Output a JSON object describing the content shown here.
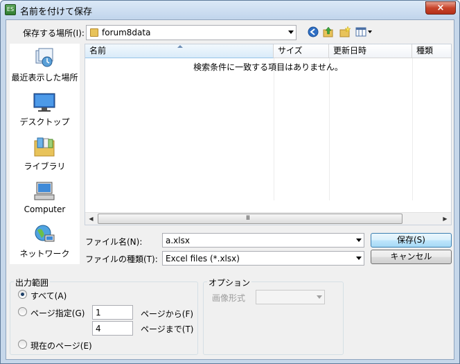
{
  "window": {
    "title": "名前を付けて保存",
    "app_icon_text": "ES",
    "close_label": "×"
  },
  "toolbar": {
    "save_in_label": "保存する場所(I):",
    "location": "forum8data",
    "icons": [
      "back-icon",
      "up-folder-icon",
      "new-folder-icon",
      "view-menu-icon"
    ]
  },
  "places": [
    {
      "label": "最近表示した場所",
      "icon": "recent-places-icon"
    },
    {
      "label": "デスクトップ",
      "icon": "desktop-icon"
    },
    {
      "label": "ライブラリ",
      "icon": "libraries-icon"
    },
    {
      "label": "Computer",
      "icon": "computer-icon"
    },
    {
      "label": "ネットワーク",
      "icon": "network-icon"
    }
  ],
  "filelist": {
    "columns": [
      "名前",
      "サイズ",
      "更新日時",
      "種類"
    ],
    "empty_message": "検索条件に一致する項目はありません。",
    "scroll_grip": "III"
  },
  "filename": {
    "label": "ファイル名(N):",
    "value": "a.xlsx"
  },
  "filetype": {
    "label": "ファイルの種類(T):",
    "value": "Excel files (*.xlsx)"
  },
  "buttons": {
    "save": "保存(S)",
    "cancel": "キャンセル"
  },
  "output_range": {
    "title": "出力範囲",
    "all": "すべて(A)",
    "page_spec": "ページ指定(G)",
    "from_value": "1",
    "from_label": "ページから(F)",
    "to_value": "4",
    "to_label": "ページまで(T)",
    "current_page": "現在のページ(E)",
    "selected": "all"
  },
  "options": {
    "title": "オプション",
    "image_format_label": "画像形式",
    "image_format_value": ""
  }
}
